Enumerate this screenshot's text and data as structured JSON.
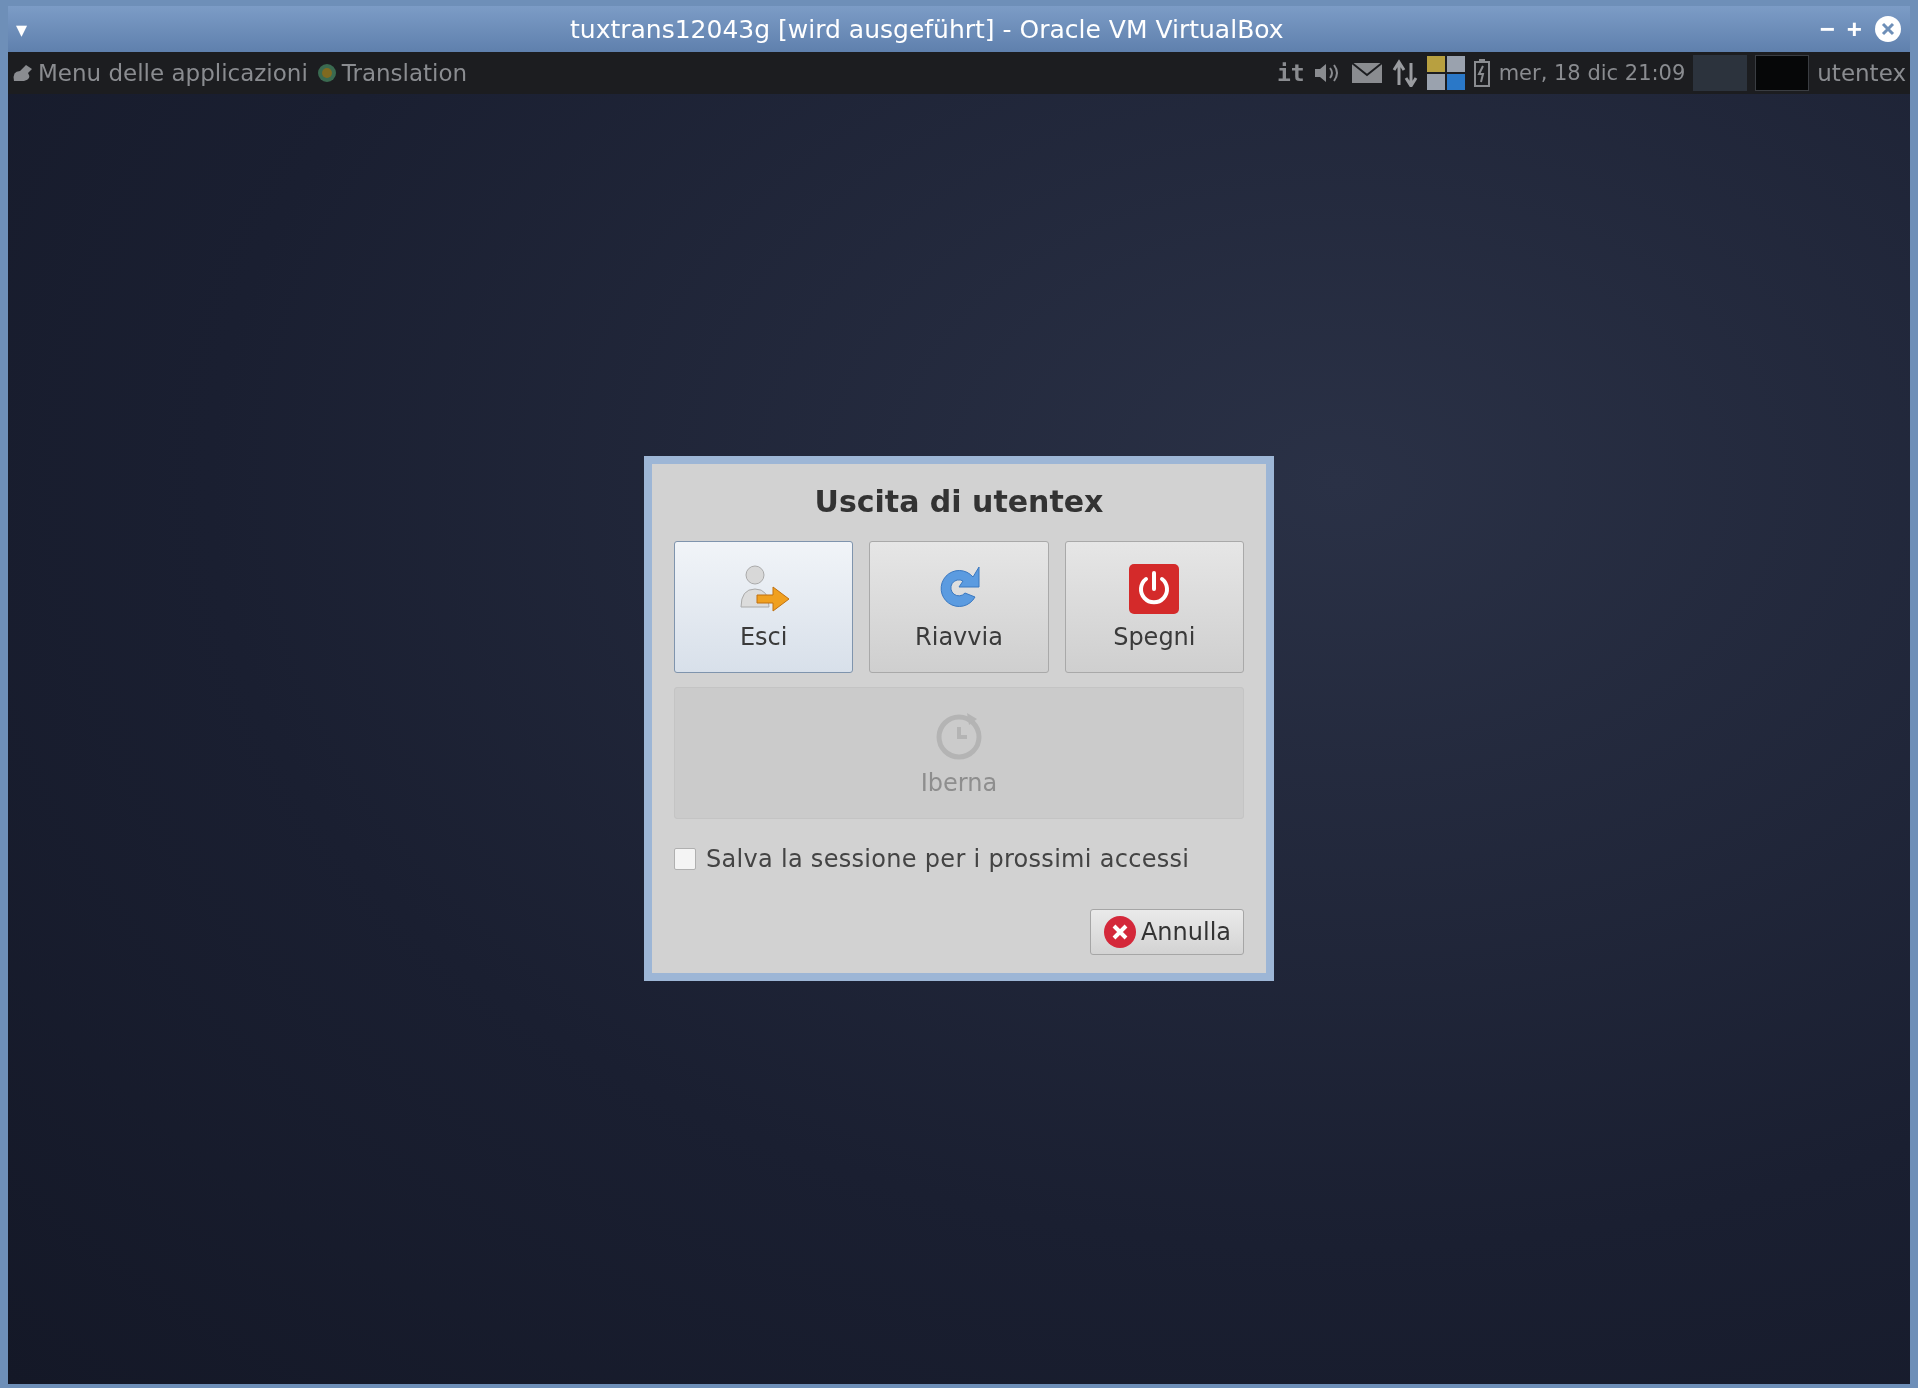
{
  "window": {
    "title": "tuxtrans12043g [wird ausgeführt] - Oracle VM VirtualBox",
    "menu_glyph": "▾",
    "controls": [
      {
        "kind": "minimize",
        "label": "−"
      },
      {
        "kind": "maximize",
        "label": "+"
      },
      {
        "kind": "close"
      }
    ]
  },
  "panel": {
    "app_menu": "Menu delle applicazioni",
    "launcher": "Translation",
    "keyboard_layout": "it",
    "tray": [
      {
        "kind": "volume"
      },
      {
        "kind": "mail"
      },
      {
        "kind": "network"
      },
      {
        "kind": "pager"
      },
      {
        "kind": "battery"
      }
    ],
    "clock": "mer, 18 dic 21:09",
    "user": "utentex"
  },
  "dialog": {
    "title": "Uscita di utentex",
    "actions": [
      {
        "kind": "logout",
        "label": "Esci",
        "hovered": true,
        "disabled": false
      },
      {
        "kind": "restart",
        "label": "Riavvia",
        "hovered": false,
        "disabled": false
      },
      {
        "kind": "shutdown",
        "label": "Spegni",
        "hovered": false,
        "disabled": false
      },
      {
        "kind": "hibernate",
        "label": "Iberna",
        "hovered": false,
        "disabled": true
      }
    ],
    "save_session": {
      "label": "Salva la sessione per i prossimi accessi",
      "checked": false
    },
    "cancel": "Annulla"
  }
}
